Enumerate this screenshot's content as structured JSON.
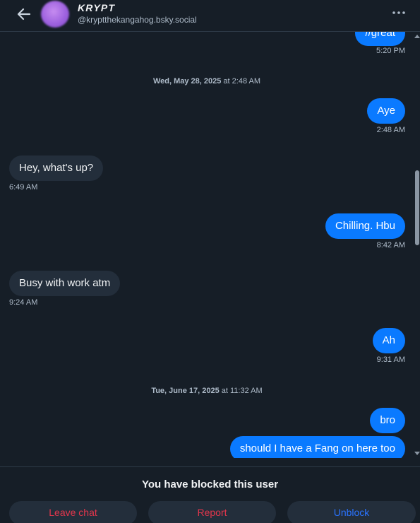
{
  "header": {
    "display_name": "KRYPT",
    "handle": "@kryptthekangahog.bsky.social",
    "back_icon": "arrow-left-icon",
    "more_icon": "ellipsis-icon"
  },
  "messages": [
    {
      "side": "out",
      "text": "//great",
      "time": "5:20 PM"
    },
    {
      "date_label": "Wed, May 28, 2025",
      "date_suffix": " at 2:48 AM"
    },
    {
      "side": "out",
      "text": "Aye",
      "time": "2:48 AM"
    },
    {
      "side": "in",
      "text": "Hey, what's up?",
      "time": "6:49 AM"
    },
    {
      "side": "out",
      "text": "Chilling. Hbu",
      "time": "8:42 AM"
    },
    {
      "side": "in",
      "text": "Busy with work atm",
      "time": "9:24 AM"
    },
    {
      "side": "out",
      "text": "Ah",
      "time": "9:31 AM"
    },
    {
      "date_label": "Tue, June 17, 2025",
      "date_suffix": " at 11:32 AM"
    },
    {
      "side": "out",
      "text": "bro"
    },
    {
      "side": "out",
      "text": "should I have a Fang on here too"
    }
  ],
  "footer": {
    "blocked_text": "You have blocked this user",
    "leave_label": "Leave chat",
    "report_label": "Report",
    "unblock_label": "Unblock"
  },
  "colors": {
    "background": "#161e27",
    "outgoing_bubble": "#0a7aff",
    "incoming_bubble": "#232e3b",
    "danger": "#e4364c",
    "link": "#2a73ff"
  }
}
